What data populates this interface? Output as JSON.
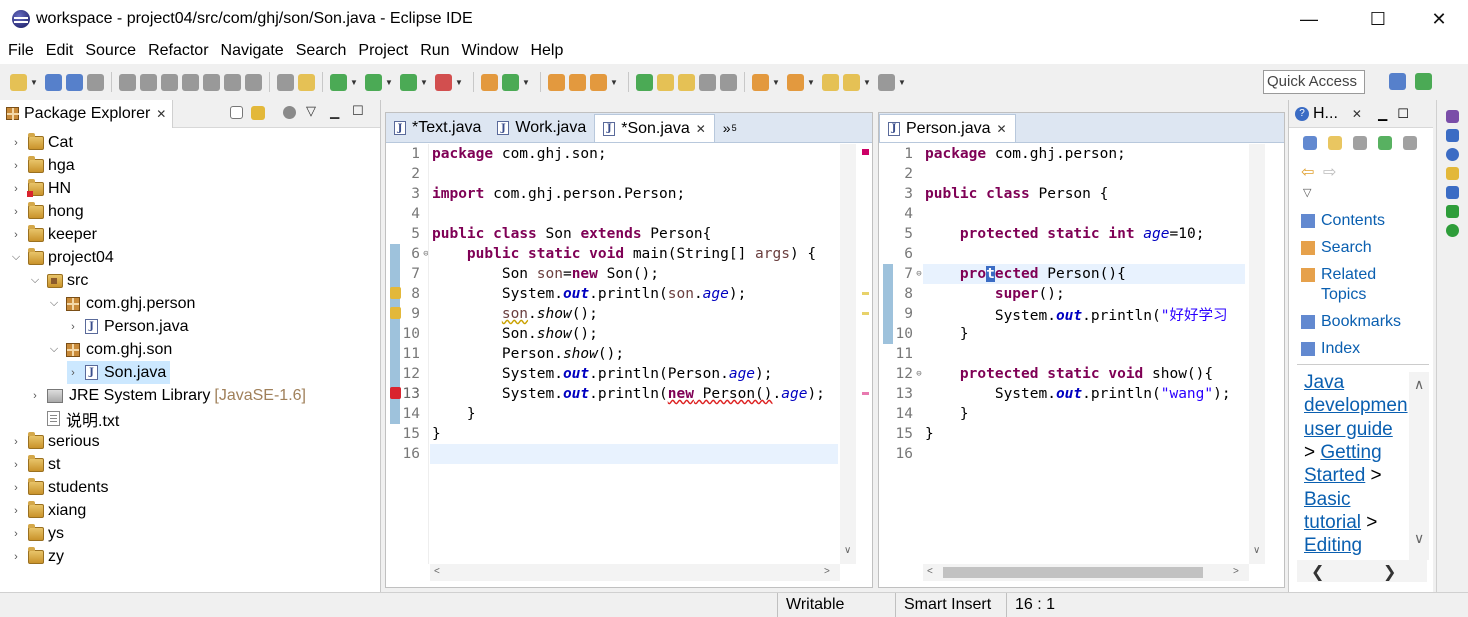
{
  "window": {
    "title": "workspace - project04/src/com/ghj/son/Son.java - Eclipse IDE",
    "controls": {
      "minimize": "—",
      "maximize": "☐",
      "close": "✕"
    }
  },
  "menu": [
    {
      "label": "File",
      "mnemonic": "F",
      "rest": "ile"
    },
    {
      "label": "Edit",
      "mnemonic": "E",
      "rest": "dit"
    },
    {
      "label": "Source",
      "mnemonic": "S",
      "rest": "ource"
    },
    {
      "label": "Refactor",
      "pre": "Refac",
      "mnemonic": "t",
      "rest": "or"
    },
    {
      "label": "Navigate",
      "mnemonic": "N",
      "rest": "avigate"
    },
    {
      "label": "Search",
      "pre": "Se",
      "mnemonic": "a",
      "rest": "rch"
    },
    {
      "label": "Project",
      "mnemonic": "P",
      "rest": "roject"
    },
    {
      "label": "Run",
      "mnemonic": "R",
      "rest": "un"
    },
    {
      "label": "Window",
      "mnemonic": "W",
      "rest": "indow"
    },
    {
      "label": "Help",
      "mnemonic": "H",
      "rest": "elp"
    }
  ],
  "toolbar": {
    "quick_access": "Quick Access",
    "colors": {
      "green": "#2e9d3a",
      "blue": "#3b6cc4",
      "orange": "#e08a1e",
      "purple": "#7a4ea8",
      "gray": "#8a8a8a",
      "red": "#cc3333",
      "yellow": "#e3b83a"
    }
  },
  "package_explorer": {
    "tab_label": "Package Explorer",
    "items": [
      {
        "label": "Cat",
        "icon": "project-icon",
        "depth": 0,
        "arrow": "›"
      },
      {
        "label": "hga",
        "icon": "project-icon",
        "depth": 0,
        "arrow": "›"
      },
      {
        "label": "HN",
        "icon": "project-error-icon",
        "depth": 0,
        "arrow": "›"
      },
      {
        "label": "hong",
        "icon": "project-icon",
        "depth": 0,
        "arrow": "›"
      },
      {
        "label": "keeper",
        "icon": "project-icon",
        "depth": 0,
        "arrow": "›"
      },
      {
        "label": "project04",
        "icon": "project-icon",
        "depth": 0,
        "arrow": "⌄"
      },
      {
        "label": "src",
        "icon": "source-folder-icon",
        "depth": 1,
        "arrow": "⌄"
      },
      {
        "label": "com.ghj.person",
        "icon": "package-icon",
        "depth": 2,
        "arrow": "⌄"
      },
      {
        "label": "Person.java",
        "icon": "java-file-icon",
        "depth": 3,
        "arrow": "›"
      },
      {
        "label": "com.ghj.son",
        "icon": "package-icon",
        "depth": 2,
        "arrow": "⌄"
      },
      {
        "label": "Son.java",
        "icon": "java-file-icon",
        "depth": 3,
        "arrow": "›",
        "selected": true
      },
      {
        "label": "JRE System Library",
        "suffix": "[JavaSE-1.6]",
        "icon": "library-icon",
        "depth": 1,
        "arrow": "›"
      },
      {
        "label": "说明.txt",
        "icon": "text-file-icon",
        "depth": 1,
        "arrow": ""
      },
      {
        "label": "serious",
        "icon": "project-icon",
        "depth": 0,
        "arrow": "›"
      },
      {
        "label": "st",
        "icon": "project-icon",
        "depth": 0,
        "arrow": "›"
      },
      {
        "label": "students",
        "icon": "project-icon",
        "depth": 0,
        "arrow": "›"
      },
      {
        "label": "xiang",
        "icon": "project-icon",
        "depth": 0,
        "arrow": "›"
      },
      {
        "label": "ys",
        "icon": "project-icon",
        "depth": 0,
        "arrow": "›"
      },
      {
        "label": "zy",
        "icon": "project-icon",
        "depth": 0,
        "arrow": "›"
      }
    ]
  },
  "editor_left": {
    "tabs": [
      {
        "label": "*Text.java",
        "active": false
      },
      {
        "label": "Work.java",
        "active": false
      },
      {
        "label": "*Son.java",
        "active": true
      }
    ],
    "overflow_label": "»",
    "overflow_count": "5",
    "lines": [
      {
        "n": "1",
        "tokens": [
          [
            "kw",
            "package"
          ],
          [
            "p",
            " com.ghj.son;"
          ]
        ]
      },
      {
        "n": "2",
        "tokens": []
      },
      {
        "n": "3",
        "tokens": [
          [
            "kw",
            "import"
          ],
          [
            "p",
            " com.ghj.person.Person;"
          ]
        ]
      },
      {
        "n": "4",
        "tokens": []
      },
      {
        "n": "5",
        "tokens": [
          [
            "kw",
            "public"
          ],
          [
            "p",
            " "
          ],
          [
            "kw",
            "class"
          ],
          [
            "p",
            " Son "
          ],
          [
            "kw",
            "extends"
          ],
          [
            "p",
            " Person{"
          ]
        ]
      },
      {
        "n": "6",
        "fold": "⊖",
        "tokens": [
          [
            "p",
            "    "
          ],
          [
            "kw",
            "public"
          ],
          [
            "p",
            " "
          ],
          [
            "kw",
            "static"
          ],
          [
            "p",
            " "
          ],
          [
            "kw",
            "void"
          ],
          [
            "p",
            " main(String[] "
          ],
          [
            "prm",
            "args"
          ],
          [
            "p",
            ") {"
          ]
        ]
      },
      {
        "n": "7",
        "tokens": [
          [
            "p",
            "        Son "
          ],
          [
            "lvar",
            "son"
          ],
          [
            "p",
            "="
          ],
          [
            "kw",
            "new"
          ],
          [
            "p",
            " Son();"
          ]
        ]
      },
      {
        "n": "8",
        "marker": "warning",
        "tokens": [
          [
            "p",
            "        System."
          ],
          [
            "sfld",
            "out"
          ],
          [
            "p",
            ".println("
          ],
          [
            "lvar",
            "son"
          ],
          [
            "p",
            "."
          ],
          [
            "fld",
            "age"
          ],
          [
            "p",
            ");"
          ]
        ]
      },
      {
        "n": "9",
        "marker": "warning",
        "tokens": [
          [
            "p",
            "        "
          ],
          [
            "squig-y",
            "son"
          ],
          [
            "p",
            "."
          ],
          [
            "mth",
            "show"
          ],
          [
            "p",
            "();"
          ]
        ]
      },
      {
        "n": "10",
        "tokens": [
          [
            "p",
            "        Son."
          ],
          [
            "mth",
            "show"
          ],
          [
            "p",
            "();"
          ]
        ]
      },
      {
        "n": "11",
        "tokens": [
          [
            "p",
            "        Person."
          ],
          [
            "mth",
            "show"
          ],
          [
            "p",
            "();"
          ]
        ]
      },
      {
        "n": "12",
        "tokens": [
          [
            "p",
            "        System."
          ],
          [
            "sfld",
            "out"
          ],
          [
            "p",
            ".println(Person."
          ],
          [
            "fld",
            "age"
          ],
          [
            "p",
            ");"
          ]
        ]
      },
      {
        "n": "13",
        "marker": "error",
        "tokens": [
          [
            "p",
            "        System."
          ],
          [
            "sfld",
            "out"
          ],
          [
            "p",
            ".println("
          ],
          [
            "squig-kw",
            "new"
          ],
          [
            "squig",
            " Person()"
          ],
          [
            "p",
            "."
          ],
          [
            "fld",
            "age"
          ],
          [
            "p",
            ");"
          ]
        ]
      },
      {
        "n": "14",
        "tokens": [
          [
            "p",
            "    }"
          ]
        ]
      },
      {
        "n": "15",
        "tokens": [
          [
            "p",
            "}"
          ]
        ]
      },
      {
        "n": "16",
        "tokens": [],
        "current": true
      }
    ]
  },
  "editor_right": {
    "tabs": [
      {
        "label": "Person.java",
        "active": true
      }
    ],
    "lines": [
      {
        "n": "1",
        "tokens": [
          [
            "kw",
            "package"
          ],
          [
            "p",
            " com.ghj.person;"
          ]
        ]
      },
      {
        "n": "2",
        "tokens": []
      },
      {
        "n": "3",
        "tokens": [
          [
            "kw",
            "public"
          ],
          [
            "p",
            " "
          ],
          [
            "kw",
            "class"
          ],
          [
            "p",
            " Person {"
          ]
        ]
      },
      {
        "n": "4",
        "tokens": []
      },
      {
        "n": "5",
        "tokens": [
          [
            "p",
            "    "
          ],
          [
            "kw",
            "protected"
          ],
          [
            "p",
            " "
          ],
          [
            "kw",
            "static"
          ],
          [
            "p",
            " "
          ],
          [
            "kw",
            "int"
          ],
          [
            "p",
            " "
          ],
          [
            "fld",
            "age"
          ],
          [
            "p",
            "=10;"
          ]
        ]
      },
      {
        "n": "6",
        "tokens": []
      },
      {
        "n": "7",
        "fold": "⊖",
        "current": true,
        "tokens": [
          [
            "p",
            "    "
          ],
          [
            "kw",
            "pro"
          ],
          [
            "cursor",
            "t"
          ],
          [
            "kw",
            "ected"
          ],
          [
            "p",
            " Person(){"
          ]
        ]
      },
      {
        "n": "8",
        "tokens": [
          [
            "p",
            "        "
          ],
          [
            "kw",
            "super"
          ],
          [
            "p",
            "();"
          ]
        ]
      },
      {
        "n": "9",
        "tokens": [
          [
            "p",
            "        System."
          ],
          [
            "sfld",
            "out"
          ],
          [
            "p",
            ".println("
          ],
          [
            "str",
            "\"好好学习"
          ]
        ]
      },
      {
        "n": "10",
        "tokens": [
          [
            "p",
            "    }"
          ]
        ]
      },
      {
        "n": "11",
        "tokens": []
      },
      {
        "n": "12",
        "fold": "⊖",
        "tokens": [
          [
            "p",
            "    "
          ],
          [
            "kw",
            "protected"
          ],
          [
            "p",
            " "
          ],
          [
            "kw",
            "static"
          ],
          [
            "p",
            " "
          ],
          [
            "kw",
            "void"
          ],
          [
            "p",
            " show(){"
          ]
        ]
      },
      {
        "n": "13",
        "tokens": [
          [
            "p",
            "        System."
          ],
          [
            "sfld",
            "out"
          ],
          [
            "p",
            ".println("
          ],
          [
            "str",
            "\"wang\""
          ],
          [
            "p",
            ");"
          ]
        ]
      },
      {
        "n": "14",
        "tokens": [
          [
            "p",
            "    }"
          ]
        ]
      },
      {
        "n": "15",
        "tokens": [
          [
            "p",
            "}"
          ]
        ]
      },
      {
        "n": "16",
        "tokens": []
      }
    ]
  },
  "help": {
    "tab_label": "H...",
    "links": [
      "Contents",
      "Search",
      "Related",
      "Topics",
      "Bookmarks",
      "Index"
    ],
    "toc": [
      {
        "text": "Java",
        "link": true
      },
      {
        "text": "developmen",
        "link": true
      },
      {
        "text": "user guide",
        "link": true
      },
      {
        "pre": "> ",
        "text": "Getting",
        "link": true
      },
      {
        "text": "Started",
        "link": true,
        "post": " >"
      },
      {
        "text": "Basic",
        "link": true
      },
      {
        "text": "tutorial",
        "link": true,
        "post": " >"
      },
      {
        "text": "Editing",
        "link": true
      }
    ]
  },
  "status": {
    "writable": "Writable",
    "insert_mode": "Smart Insert",
    "position": "16 : 1"
  }
}
